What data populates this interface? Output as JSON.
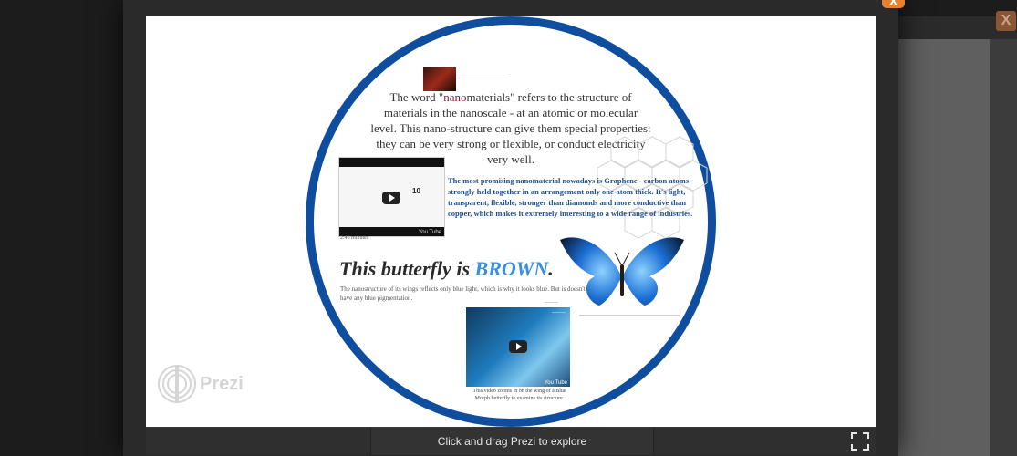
{
  "page": {
    "close_label": "X",
    "bg_close_label": "X"
  },
  "prezi": {
    "intro_before": "The word \"",
    "intro_highlight": "nano",
    "intro_after": "materials\" refers to the structure of materials in the nanoscale - at an atomic or molecular level. This nano-structure can give them special properties: they can be very strong or flexible, or conduct electricity very well.",
    "video1_duration": "2:45 minutes",
    "video1_inner_text": "10",
    "graphene_text": "The most promising nanomaterial nowadays is Graphene - carbon atoms strongly held together in an arrangement only one-atom thick. It's light, transparent, flexible, stronger than diamonds and more conductive than copper, which makes it extremely interesting to a wide range of industries.",
    "butterfly_title_before": "This butterfly is ",
    "butterfly_title_color_word": "BROWN",
    "butterfly_title_after": ".",
    "butterfly_sub": "The nanostructure of its wings reflects only blue light, which is why it looks blue. But is doesn't have any blue pigmentation.",
    "video2_caption": "This video zooms in on the wing of a Blue Morph butterfly to examine its structure.",
    "youtube_label": "You Tube",
    "logo_text": "Prezi"
  },
  "controls": {
    "explore_label": "Click and drag Prezi to explore"
  },
  "colors": {
    "ring": "#0f4d9e",
    "close_button": "#e8812e",
    "brown_word": "#3a8ee0",
    "graphene_text": "#1e4f8a"
  }
}
